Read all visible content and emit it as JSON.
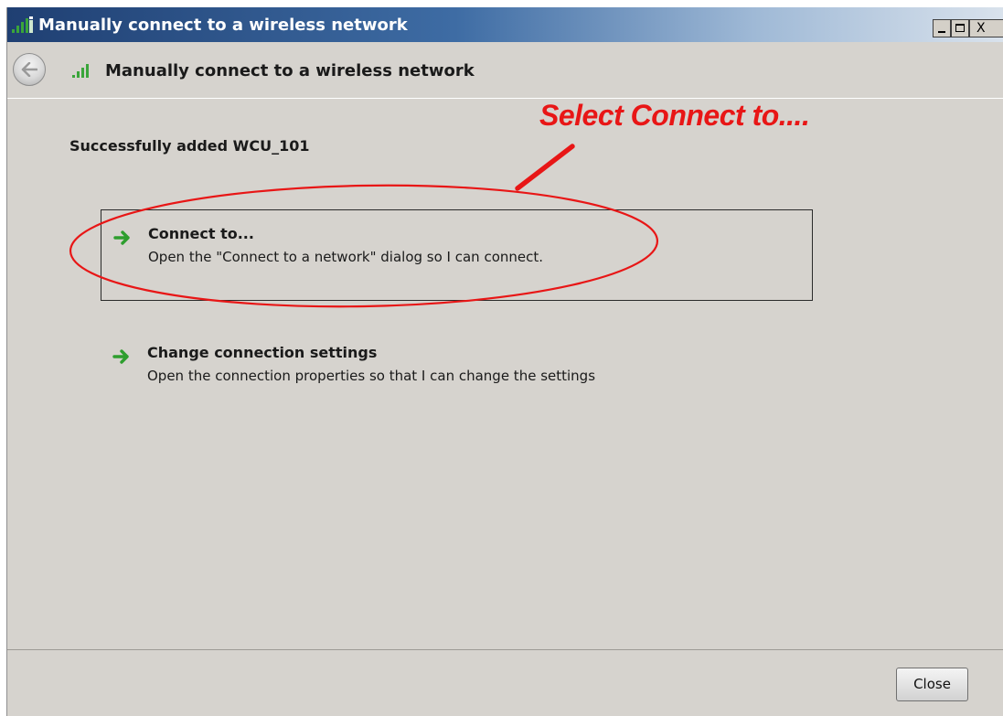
{
  "window": {
    "title": "Manually connect to a wireless network",
    "controls": {
      "minimize": "",
      "maximize": "",
      "close": "X"
    }
  },
  "header": {
    "title": "Manually connect to a wireless network"
  },
  "main": {
    "status": "Successfully added WCU_101",
    "options": [
      {
        "title": "Connect to...",
        "description": "Open the \"Connect to a network\" dialog so I can connect."
      },
      {
        "title": "Change connection settings",
        "description": "Open the connection properties so that I can change the settings"
      }
    ]
  },
  "annotation": {
    "text": "Select Connect to....",
    "color": "#e81616"
  },
  "footer": {
    "close_label": "Close"
  },
  "colors": {
    "titlebar_start": "#1f3f72",
    "window_bg": "#d6d3ce",
    "arrow_green": "#2e9e2e",
    "signal_green": "#3aa53a"
  }
}
